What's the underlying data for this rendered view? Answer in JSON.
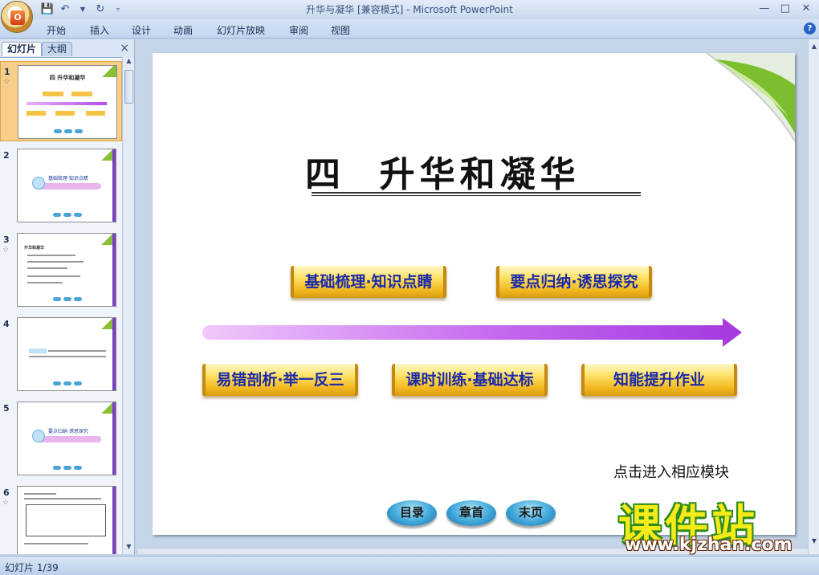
{
  "window": {
    "title": "升华与凝华 [兼容模式] - Microsoft PowerPoint",
    "controls": [
      "minimize-icon",
      "maximize-icon",
      "close-icon"
    ]
  },
  "quick_access": [
    "save-icon",
    "undo-icon",
    "dropdown-icon",
    "redo-icon",
    "customize-icon"
  ],
  "ribbon": {
    "tabs": [
      "开始",
      "插入",
      "设计",
      "动画",
      "幻灯片放映",
      "审阅",
      "视图"
    ],
    "help": "?"
  },
  "panel": {
    "tabs": [
      "幻灯片",
      "大纲"
    ],
    "close": "×",
    "thumbnails": [
      {
        "number": "1",
        "title": "四 升华和凝华"
      },
      {
        "number": "2",
        "label": "基础梳理·知识点睛"
      },
      {
        "number": "3",
        "label": "升华和凝华"
      },
      {
        "number": "4",
        "label": ""
      },
      {
        "number": "5",
        "label": "要点归纳·诱思探究"
      },
      {
        "number": "6",
        "label": ""
      }
    ]
  },
  "slide": {
    "title": "四  升华和凝华",
    "banners": [
      "基础梳理·知识点睛",
      "要点归纳·诱思探究",
      "易错剖析·举一反三",
      "课时训练·基础达标",
      "知能提升作业"
    ],
    "hint": "点击进入相应模块",
    "nav": [
      "目录",
      "章首",
      "末页"
    ]
  },
  "watermark": {
    "text": "课件站",
    "url": "www.kjzhan.com"
  },
  "status": {
    "slide_counter": "幻灯片 1/39"
  }
}
